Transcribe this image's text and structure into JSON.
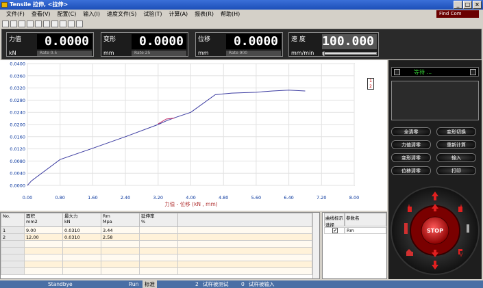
{
  "window": {
    "title": "Tensile 拉伸, <拉伸>",
    "buttons": [
      "_",
      "□",
      "×"
    ]
  },
  "menu": [
    "文件(F)",
    "查看(V)",
    "配置(C)",
    "输入(I)",
    "速度文件(S)",
    "试验(T)",
    "计算(A)",
    "报表(R)",
    "帮助(H)"
  ],
  "find_com": "Find Com",
  "readouts": [
    {
      "label": "力值",
      "unit": "kN",
      "value": "0.0000",
      "rate": "Rate    0.5"
    },
    {
      "label": "变形",
      "unit": "mm",
      "value": "0.0000",
      "rate": "Rate    25"
    },
    {
      "label": "位移",
      "unit": "mm",
      "value": "0.0000",
      "rate": "Rate    900"
    }
  ],
  "speed": {
    "label": "速  度",
    "unit": "mm/min",
    "value": "100.000",
    "slider_fraction": 0.0
  },
  "chart_data": {
    "type": "line",
    "xlabel": "力值 - 位移  (kN , mm)",
    "ylabel": "",
    "xlim": [
      0,
      8
    ],
    "ylim": [
      0,
      0.04
    ],
    "x_ticks": [
      "0.00",
      "0.80",
      "1.60",
      "2.40",
      "3.20",
      "4.00",
      "4.80",
      "5.60",
      "6.40",
      "7.20",
      "8.00"
    ],
    "y_ticks": [
      "0.0000",
      "0.0040",
      "0.0080",
      "0.0120",
      "0.0160",
      "0.0200",
      "0.0240",
      "0.0280",
      "0.0320",
      "0.0360",
      "0.0400"
    ],
    "grid": true,
    "series": [
      {
        "color": "#3a3aa0",
        "x": [
          0,
          0.1,
          0.8,
          1.6,
          2.4,
          3.2,
          3.4,
          3.6,
          4.0,
          4.6,
          5.0,
          5.6,
          6.0,
          6.4,
          6.8
        ],
        "y": [
          0,
          0.0015,
          0.0085,
          0.0122,
          0.016,
          0.02,
          0.0212,
          0.0222,
          0.024,
          0.0298,
          0.0303,
          0.0306,
          0.031,
          0.0313,
          0.031
        ]
      },
      {
        "color": "#c0306a",
        "x": [
          3.2,
          3.4,
          3.6
        ],
        "y": [
          0.0202,
          0.0218,
          0.0221
        ]
      }
    ]
  },
  "legend_box": [
    "1",
    "2"
  ],
  "status_text": "等待 ...",
  "panel_buttons": [
    "全清零",
    "变形切换",
    "力值清零",
    "重新计算",
    "变形清零",
    "输入",
    "位移清零",
    "打印"
  ],
  "jog": {
    "stop_label": "STOP"
  },
  "table": {
    "headers": [
      [
        "No.",
        ""
      ],
      [
        "面积",
        "mm2"
      ],
      [
        "最大力",
        "kN"
      ],
      [
        "Rm",
        "Mpa"
      ],
      [
        "延伸率",
        "%"
      ],
      [
        "",
        ""
      ]
    ],
    "rows": [
      [
        "1",
        "9.00",
        "0.0310",
        "3.44",
        "",
        ""
      ],
      [
        "2",
        "12.00",
        "0.0310",
        "2.58",
        "",
        ""
      ]
    ]
  },
  "curve_select": {
    "header1": "曲线标示选择",
    "header2": "参数名",
    "checkbox": "✔",
    "param": "Rm"
  },
  "statusbar": {
    "state": "Standbye",
    "run": "Run",
    "mode": "标准",
    "count": "2",
    "msg1": "试样被测试",
    "zero": "0",
    "msg2": "试样被输入"
  }
}
